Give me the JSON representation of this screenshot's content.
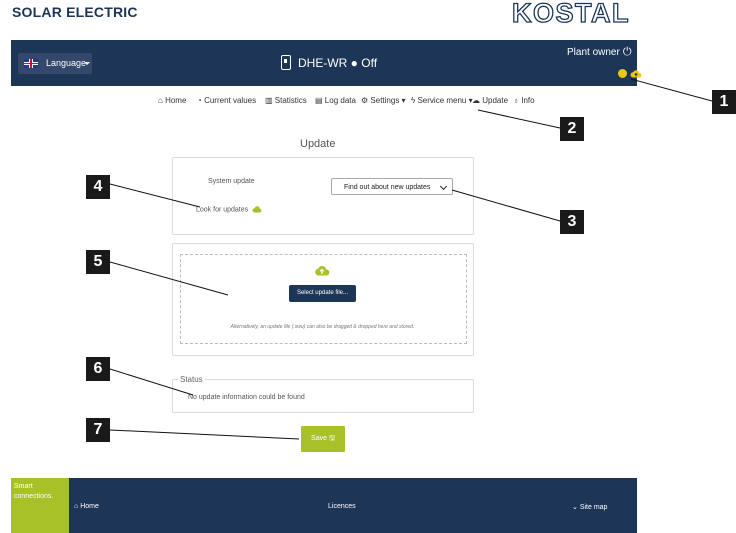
{
  "brand": {
    "left": "SOLAR ELECTRIC",
    "right": "KOSTAL"
  },
  "header": {
    "language_label": "Language",
    "device_name": "DHE-WR",
    "device_status": "Off",
    "user_label": "Plant owner"
  },
  "nav": {
    "items": [
      "Home",
      "Current values",
      "Statistics",
      "Log data",
      "Settings",
      "Service menu",
      "Update",
      "Info"
    ]
  },
  "page": {
    "title": "Update"
  },
  "system_update": {
    "label": "System update",
    "look_for_updates": "Look for updates",
    "select_value": "Find out about new updates"
  },
  "upload": {
    "button_label": "Select update file...",
    "hint": "Alternatively, an update file (.swu) can also be dragged & dropped here and stored."
  },
  "status": {
    "legend": "Status",
    "message": "No update information could be found"
  },
  "save": {
    "label": "Save"
  },
  "footer": {
    "tagline": "Smart connections.",
    "home": "Home",
    "licences": "Licences",
    "sitemap": "Site map"
  },
  "callouts": [
    "1",
    "2",
    "3",
    "4",
    "5",
    "6",
    "7"
  ],
  "colors": {
    "navy": "#1d3557",
    "green": "#a8c128",
    "yellow": "#e9c80f"
  },
  "icons": {
    "flag": "uk-flag-icon",
    "device": "inverter-icon",
    "power": "power-icon",
    "cloud": "cloud-icon",
    "upload": "cloud-upload-icon"
  }
}
